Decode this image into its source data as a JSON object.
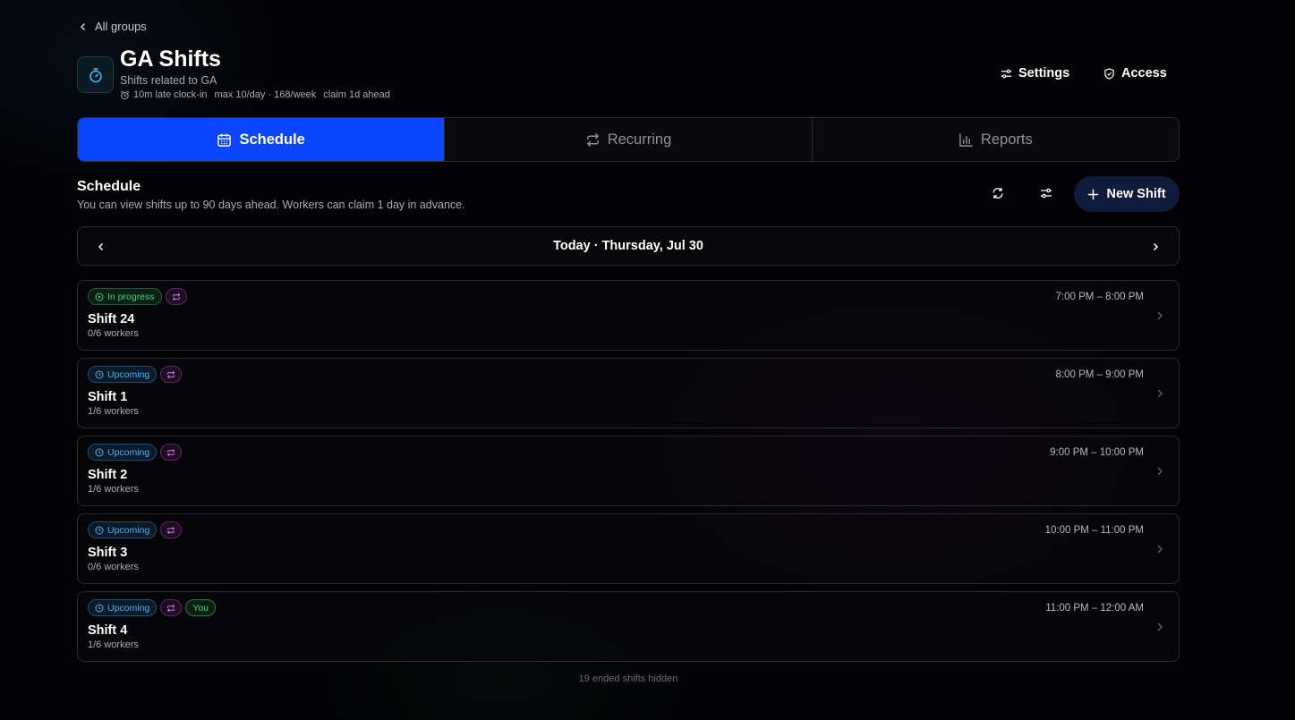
{
  "nav": {
    "back_label": "All groups"
  },
  "header": {
    "title": "GA Shifts",
    "subtitle": "Shifts related to GA",
    "meta": {
      "late_clock_in": "10m late clock-in",
      "limits": "max 10/day · 168/week",
      "claim": "claim 1d ahead"
    },
    "settings_label": "Settings",
    "access_label": "Access"
  },
  "tabs": [
    {
      "label": "Schedule",
      "active": true
    },
    {
      "label": "Recurring",
      "active": false
    },
    {
      "label": "Reports",
      "active": false
    }
  ],
  "schedule": {
    "title": "Schedule",
    "description": "You can view shifts up to 90 days ahead. Workers can claim 1 day in advance.",
    "new_shift_label": "New Shift",
    "date_label": "Today · Thursday, Jul 30"
  },
  "shifts": [
    {
      "status": "In progress",
      "name": "Shift 24",
      "workers": "0/6 workers",
      "time": "7:00 PM – 8:00 PM",
      "you": ""
    },
    {
      "status": "Upcoming",
      "name": "Shift 1",
      "workers": "1/6 workers",
      "time": "8:00 PM – 9:00 PM",
      "you": ""
    },
    {
      "status": "Upcoming",
      "name": "Shift 2",
      "workers": "1/6 workers",
      "time": "9:00 PM – 10:00 PM",
      "you": ""
    },
    {
      "status": "Upcoming",
      "name": "Shift 3",
      "workers": "0/6 workers",
      "time": "10:00 PM – 11:00 PM",
      "you": ""
    },
    {
      "status": "Upcoming",
      "name": "Shift 4",
      "workers": "1/6 workers",
      "time": "11:00 PM – 12:00 AM",
      "you": "You"
    }
  ],
  "footer": {
    "hidden_note": "19 ended shifts hidden"
  },
  "colors": {
    "accent": "#0a46ff",
    "progress": "#3fcf7a",
    "upcoming": "#4ab0f0",
    "recurring": "#d57ae6"
  }
}
